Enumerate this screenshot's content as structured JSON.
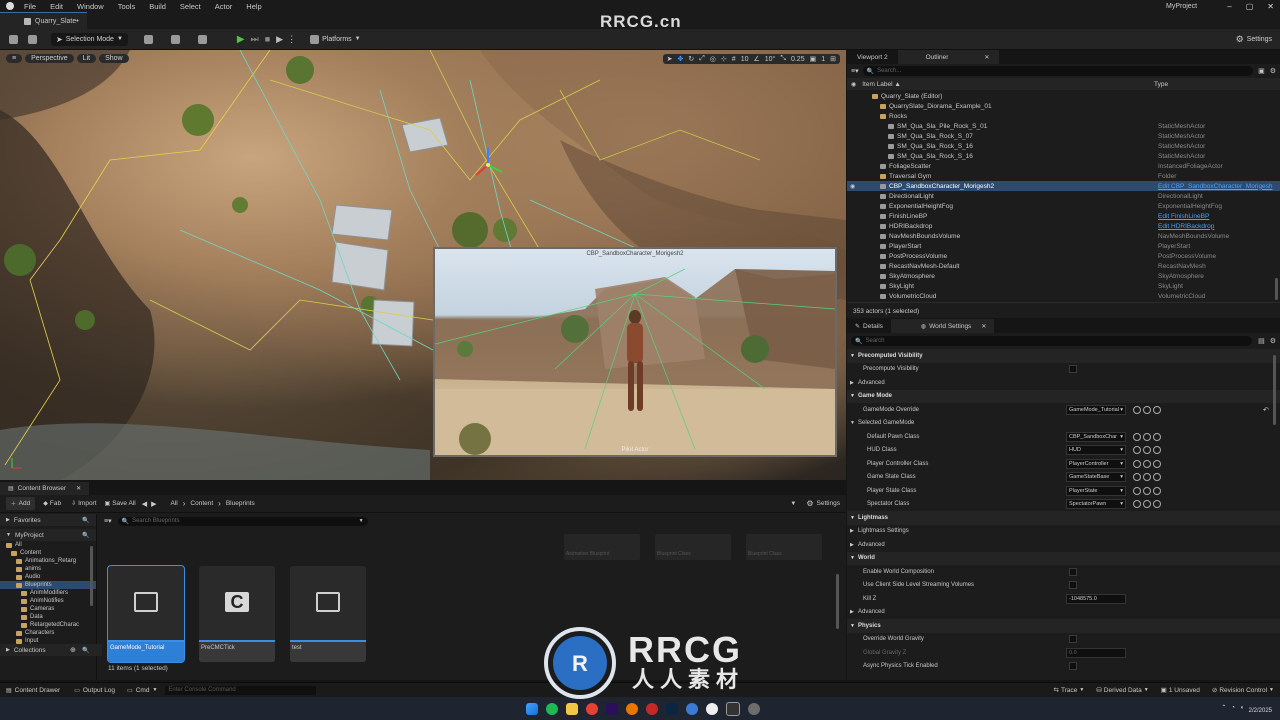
{
  "menu": [
    "File",
    "Edit",
    "Window",
    "Tools",
    "Build",
    "Select",
    "Actor",
    "Help"
  ],
  "project_name": "MyProject",
  "level_tab": "Quarry_Slate•",
  "watermark_top": "RRCG.cn",
  "toolbar": {
    "selection_mode": "Selection Mode",
    "platforms": "Platforms",
    "settings": "Settings"
  },
  "viewport": {
    "perspective": "Perspective",
    "lit": "Lit",
    "show": "Show",
    "grid_value": "10",
    "angle_value": "10°",
    "scale_value": "0.25",
    "camera_speed": "1",
    "pip_title": "CBP_SandboxCharacter_Morigesh2",
    "pip_footer": "Pilot Actor"
  },
  "outliner": {
    "tabs": [
      "Viewport 2",
      "Outliner"
    ],
    "search_placeholder": "Search...",
    "col_label": "Item Label ▲",
    "col_type": "Type",
    "rows": [
      {
        "label": "Quarry_Slate (Editor)",
        "type": "",
        "indent": 0
      },
      {
        "label": "QuarrySlate_Diorama_Example_01",
        "type": "",
        "indent": 1
      },
      {
        "label": "Rocks",
        "type": "",
        "indent": 1
      },
      {
        "label": "SM_Qua_Sla_Pile_Rock_S_01",
        "type": "StaticMeshActor",
        "indent": 2
      },
      {
        "label": "SM_Qua_Sla_Rock_S_07",
        "type": "StaticMeshActor",
        "indent": 2
      },
      {
        "label": "SM_Qua_Sla_Rock_S_16",
        "type": "StaticMeshActor",
        "indent": 2
      },
      {
        "label": "SM_Qua_Sla_Rock_S_16",
        "type": "StaticMeshActor",
        "indent": 2
      },
      {
        "label": "FoliageScatter",
        "type": "InstancedFoliageActor",
        "indent": 1
      },
      {
        "label": "Traversal Gym",
        "type": "Folder",
        "indent": 1
      },
      {
        "label": "CBP_SandboxCharacter_Morigesh2",
        "type": "Edit CBP_SandboxCharacter_Morigesh",
        "indent": 1,
        "selected": true
      },
      {
        "label": "DirectionalLight",
        "type": "DirectionalLight",
        "indent": 1
      },
      {
        "label": "ExponentialHeightFog",
        "type": "ExponentialHeightFog",
        "indent": 1
      },
      {
        "label": "FinishLineBP",
        "type": "Edit FinishLineBP",
        "indent": 1
      },
      {
        "label": "HDRIBackdrop",
        "type": "Edit HDRIBackdrop",
        "indent": 1
      },
      {
        "label": "NavMeshBoundsVolume",
        "type": "NavMeshBoundsVolume",
        "indent": 1
      },
      {
        "label": "PlayerStart",
        "type": "PlayerStart",
        "indent": 1
      },
      {
        "label": "PostProcessVolume",
        "type": "PostProcessVolume",
        "indent": 1
      },
      {
        "label": "RecastNavMesh-Default",
        "type": "RecastNavMesh",
        "indent": 1
      },
      {
        "label": "SkyAtmosphere",
        "type": "SkyAtmosphere",
        "indent": 1
      },
      {
        "label": "SkyLight",
        "type": "SkyLight",
        "indent": 1
      },
      {
        "label": "VolumetricCloud",
        "type": "VolumetricCloud",
        "indent": 1
      }
    ],
    "footer": "353 actors (1 selected)"
  },
  "details": {
    "tabs": [
      "Details",
      "World Settings"
    ],
    "search_placeholder": "Search",
    "rows": [
      {
        "kind": "cat",
        "label": "Precomputed Visibility"
      },
      {
        "kind": "prop",
        "label": "Precompute Visibility",
        "control": "check",
        "indent": 1
      },
      {
        "kind": "sub",
        "label": "Advanced"
      },
      {
        "kind": "cat",
        "label": "Game Mode"
      },
      {
        "kind": "prop",
        "label": "GameMode Override",
        "control": "dropdown",
        "value": "GameMode_Tutorial",
        "indent": 1
      },
      {
        "kind": "sub",
        "label": "Selected GameMode"
      },
      {
        "kind": "prop",
        "label": "Default Pawn Class",
        "control": "dropdown",
        "value": "CBP_SandboxChar",
        "indent": 2
      },
      {
        "kind": "prop",
        "label": "HUD Class",
        "control": "dropdown",
        "value": "HUD",
        "indent": 2
      },
      {
        "kind": "prop",
        "label": "Player Controller Class",
        "control": "dropdown",
        "value": "PlayerController",
        "indent": 2
      },
      {
        "kind": "prop",
        "label": "Game State Class",
        "control": "dropdown",
        "value": "GameStateBase",
        "indent": 2
      },
      {
        "kind": "prop",
        "label": "Player State Class",
        "control": "dropdown",
        "value": "PlayerState",
        "indent": 2
      },
      {
        "kind": "prop",
        "label": "Spectator Class",
        "control": "dropdown",
        "value": "SpectatorPawn",
        "indent": 2
      },
      {
        "kind": "cat",
        "label": "Lightmass"
      },
      {
        "kind": "sub",
        "label": "Lightmass Settings"
      },
      {
        "kind": "sub",
        "label": "Advanced"
      },
      {
        "kind": "cat",
        "label": "World"
      },
      {
        "kind": "prop",
        "label": "Enable World Composition",
        "control": "check",
        "indent": 1
      },
      {
        "kind": "prop",
        "label": "Use Client Side Level Streaming Volumes",
        "control": "check",
        "indent": 1
      },
      {
        "kind": "prop",
        "label": "Kill Z",
        "control": "number",
        "value": "-1048575.0",
        "indent": 1
      },
      {
        "kind": "sub",
        "label": "Advanced"
      },
      {
        "kind": "cat",
        "label": "Physics"
      },
      {
        "kind": "prop",
        "label": "Override World Gravity",
        "control": "check",
        "indent": 1
      },
      {
        "kind": "prop",
        "label": "Global Gravity Z",
        "control": "number",
        "value": "0.0",
        "indent": 1,
        "dim": true
      },
      {
        "kind": "prop",
        "label": "Async Physics Tick Enabled",
        "control": "check",
        "indent": 1
      }
    ]
  },
  "content_browser": {
    "tab": "Content Browser",
    "add": "Add",
    "fab": "Fab",
    "import": "Import",
    "save_all": "Save All",
    "path": [
      "All",
      "Content",
      "Blueprints"
    ],
    "settings": "Settings",
    "favorites": "Favorites",
    "project": "MyProject",
    "search_placeholder": "Search Blueprints",
    "tree": [
      {
        "label": "All",
        "indent": 0
      },
      {
        "label": "Content",
        "indent": 1
      },
      {
        "label": "Animations_Retarg",
        "indent": 2
      },
      {
        "label": "anims",
        "indent": 2
      },
      {
        "label": "Audio",
        "indent": 2
      },
      {
        "label": "Blueprints",
        "indent": 2,
        "selected": true
      },
      {
        "label": "AnimModifiers",
        "indent": 3
      },
      {
        "label": "AnimNotifies",
        "indent": 3
      },
      {
        "label": "Cameras",
        "indent": 3
      },
      {
        "label": "Data",
        "indent": 3
      },
      {
        "label": "RetargetedCharac",
        "indent": 3
      },
      {
        "label": "Characters",
        "indent": 2
      },
      {
        "label": "Input",
        "indent": 2
      },
      {
        "label": "LevelPrototyping",
        "indent": 2
      }
    ],
    "faded_labels": [
      "Animation Blueprint",
      "Blueprint Class",
      "Blueprint Class"
    ],
    "assets": [
      {
        "name": "GameMode_Tutorial",
        "selected": true,
        "icon": "monitor-icon"
      },
      {
        "name": "PreCMCTick",
        "selected": false,
        "icon": "c-class-icon"
      },
      {
        "name": "test",
        "selected": false,
        "icon": "monitor-icon"
      }
    ],
    "count": "11 items (1 selected)",
    "collections": "Collections"
  },
  "status": {
    "content_drawer": "Content Drawer",
    "output_log": "Output Log",
    "cmd": "Cmd",
    "console_placeholder": "Enter Console Command",
    "trace": "Trace",
    "derived_data": "Derived Data",
    "unsaved": "1 Unsaved",
    "revision_control": "Revision Control"
  },
  "watermark": {
    "brand": "RRCG",
    "cn": "人人素材"
  },
  "taskbar_date": "2/2/2025"
}
